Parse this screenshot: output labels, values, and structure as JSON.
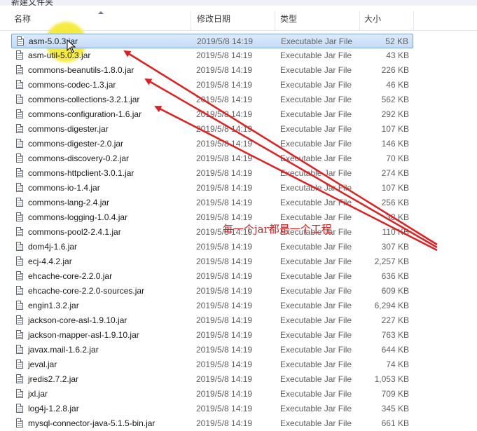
{
  "window": {
    "title": "新建文件夹"
  },
  "columns": {
    "name": "名称",
    "date": "修改日期",
    "type": "类型",
    "size": "大小"
  },
  "files": [
    {
      "name": "asm-5.0.3.jar",
      "date": "2019/5/8 14:19",
      "type": "Executable Jar File",
      "size": "52 KB",
      "selected": true
    },
    {
      "name": "asm-util-5.0.3.jar",
      "date": "2019/5/8 14:19",
      "type": "Executable Jar File",
      "size": "43 KB"
    },
    {
      "name": "commons-beanutils-1.8.0.jar",
      "date": "2019/5/8 14:19",
      "type": "Executable Jar File",
      "size": "226 KB"
    },
    {
      "name": "commons-codec-1.3.jar",
      "date": "2019/5/8 14:19",
      "type": "Executable Jar File",
      "size": "46 KB"
    },
    {
      "name": "commons-collections-3.2.1.jar",
      "date": "2019/5/8 14:19",
      "type": "Executable Jar File",
      "size": "562 KB"
    },
    {
      "name": "commons-configuration-1.6.jar",
      "date": "2019/5/8 14:19",
      "type": "Executable Jar File",
      "size": "292 KB"
    },
    {
      "name": "commons-digester.jar",
      "date": "2019/5/8 14:19",
      "type": "Executable Jar File",
      "size": "107 KB"
    },
    {
      "name": "commons-digester-2.0.jar",
      "date": "2019/5/8 14:19",
      "type": "Executable Jar File",
      "size": "146 KB"
    },
    {
      "name": "commons-discovery-0.2.jar",
      "date": "2019/5/8 14:19",
      "type": "Executable Jar File",
      "size": "70 KB"
    },
    {
      "name": "commons-httpclient-3.0.1.jar",
      "date": "2019/5/8 14:19",
      "type": "Executable Jar File",
      "size": "274 KB"
    },
    {
      "name": "commons-io-1.4.jar",
      "date": "2019/5/8 14:19",
      "type": "Executable Jar File",
      "size": "107 KB"
    },
    {
      "name": "commons-lang-2.4.jar",
      "date": "2019/5/8 14:19",
      "type": "Executable Jar File",
      "size": "256 KB"
    },
    {
      "name": "commons-logging-1.0.4.jar",
      "date": "2019/5/8 14:19",
      "type": "Executable Jar File",
      "size": "38 KB"
    },
    {
      "name": "commons-pool2-2.4.1.jar",
      "date": "2019/5/8 14:19",
      "type": "Executable Jar File",
      "size": "110 KB"
    },
    {
      "name": "dom4j-1.6.jar",
      "date": "2019/5/8 14:19",
      "type": "Executable Jar File",
      "size": "307 KB"
    },
    {
      "name": "ecj-4.4.2.jar",
      "date": "2019/5/8 14:19",
      "type": "Executable Jar File",
      "size": "2,257 KB"
    },
    {
      "name": "ehcache-core-2.2.0.jar",
      "date": "2019/5/8 14:19",
      "type": "Executable Jar File",
      "size": "636 KB"
    },
    {
      "name": "ehcache-core-2.2.0-sources.jar",
      "date": "2019/5/8 14:19",
      "type": "Executable Jar File",
      "size": "609 KB"
    },
    {
      "name": "engin1.3.2.jar",
      "date": "2019/5/8 14:19",
      "type": "Executable Jar File",
      "size": "6,294 KB"
    },
    {
      "name": "jackson-core-asl-1.9.10.jar",
      "date": "2019/5/8 14:19",
      "type": "Executable Jar File",
      "size": "227 KB"
    },
    {
      "name": "jackson-mapper-asl-1.9.10.jar",
      "date": "2019/5/8 14:19",
      "type": "Executable Jar File",
      "size": "763 KB"
    },
    {
      "name": "javax.mail-1.6.2.jar",
      "date": "2019/5/8 14:19",
      "type": "Executable Jar File",
      "size": "644 KB"
    },
    {
      "name": "jeval.jar",
      "date": "2019/5/8 14:19",
      "type": "Executable Jar File",
      "size": "74 KB"
    },
    {
      "name": "jredis2.7.2.jar",
      "date": "2019/5/8 14:19",
      "type": "Executable Jar File",
      "size": "1,053 KB"
    },
    {
      "name": "jxl.jar",
      "date": "2019/5/8 14:19",
      "type": "Executable Jar File",
      "size": "709 KB"
    },
    {
      "name": "log4j-1.2.8.jar",
      "date": "2019/5/8 14:19",
      "type": "Executable Jar File",
      "size": "345 KB"
    },
    {
      "name": "mysql-connector-java-5.1.5-bin.jar",
      "date": "2019/5/8 14:19",
      "type": "Executable Jar File",
      "size": "661 KB"
    }
  ],
  "annotation": {
    "text": "每一个jar都是一个工程",
    "color": "#d81e1e"
  },
  "colors": {
    "selection": "#c4dcf7",
    "highlight": "#f5e828",
    "arrow": "#e02020"
  }
}
